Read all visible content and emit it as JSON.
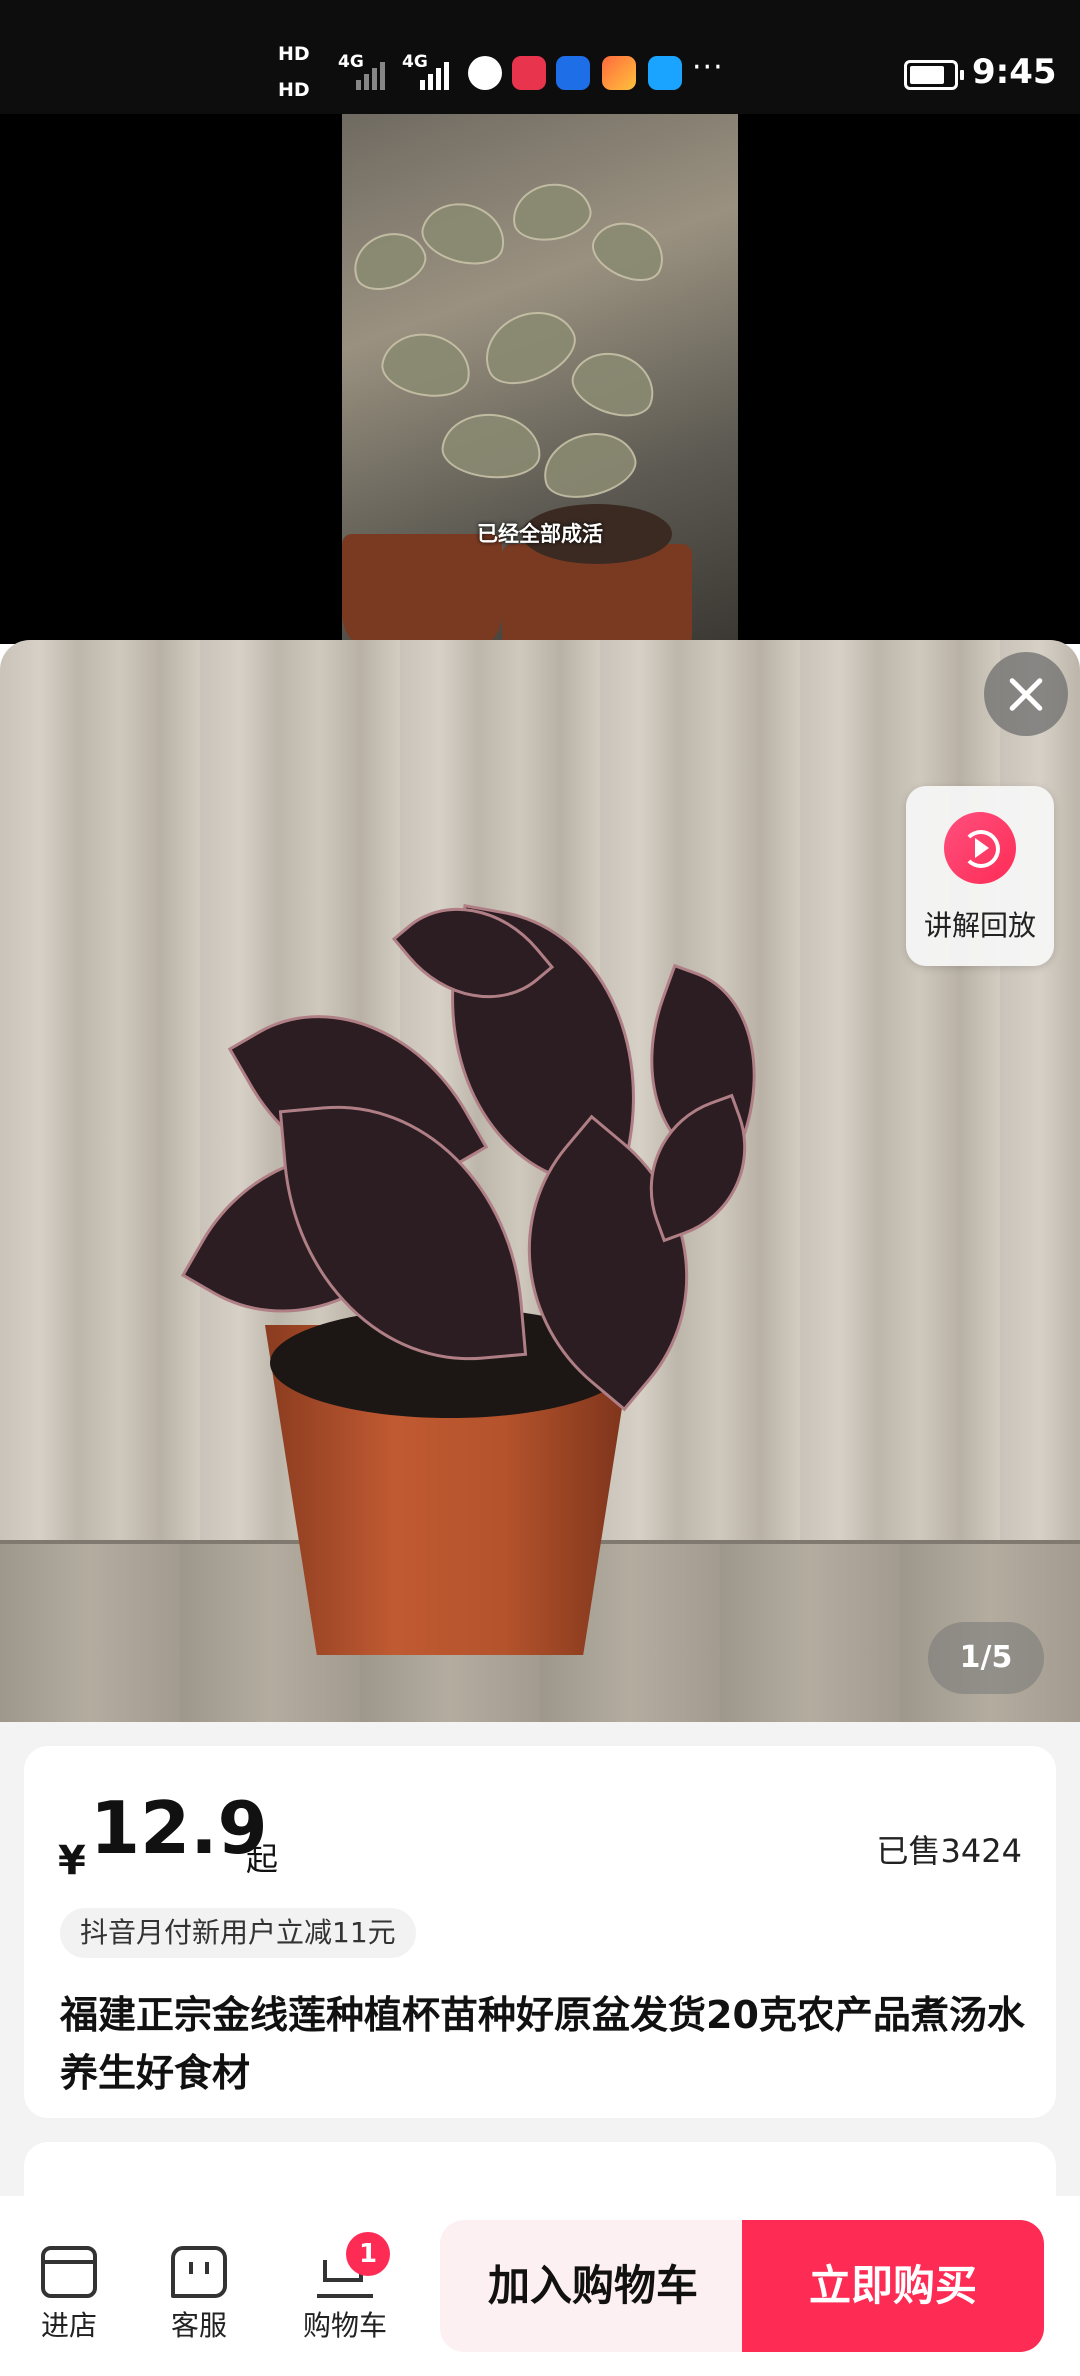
{
  "status_bar": {
    "hd1": "HD",
    "hd2": "HD",
    "net1": "4G",
    "net2": "4G",
    "more": "···",
    "time": "9:45"
  },
  "video": {
    "caption": "已经全部成活"
  },
  "gallery": {
    "replay_label": "讲解回放",
    "page_indicator": "1/5"
  },
  "product": {
    "currency": "¥",
    "price": "12.9",
    "price_suffix": "起",
    "sold": "已售3424",
    "promo": "抖音月付新用户立减11元",
    "title": "福建正宗金线莲种植杯苗种好原盆发货20克农产品煮汤水养生好食材"
  },
  "bottom_bar": {
    "store_label": "进店",
    "service_label": "客服",
    "cart_label": "购物车",
    "cart_count": "1",
    "add_to_cart": "加入购物车",
    "buy_now": "立即购买"
  },
  "colors": {
    "accent": "#fe2c55",
    "add_cart_bg": "#fdf0f2"
  }
}
